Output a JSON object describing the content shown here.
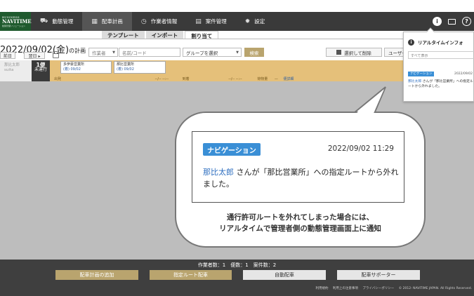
{
  "logo": {
    "line1": "BUSINESS",
    "line2": "NAVITIME",
    "line3": "動態管理ソリューション"
  },
  "nav": {
    "items": [
      {
        "label": "動態管理",
        "icon": "truck-icon"
      },
      {
        "label": "配車計画",
        "icon": "calendar-icon"
      },
      {
        "label": "作業者情報",
        "icon": "clock-icon"
      },
      {
        "label": "案件管理",
        "icon": "document-icon"
      },
      {
        "label": "設定",
        "icon": "gear-icon"
      }
    ],
    "active": "配車計画"
  },
  "subtabs": [
    "テンプレート",
    "インポート",
    "割り当て"
  ],
  "plan": {
    "date": "2022/09/02(金)",
    "suffix": "の計画",
    "prev_label": "前日",
    "next_label": "翌日 ▸"
  },
  "filters": {
    "worker_placeholder": "作業者",
    "name_placeholder": "名前/コード",
    "group_placeholder": "グループを選択",
    "search_label": "検索",
    "delete_label": "選択して削除",
    "user_label": "ユーザー"
  },
  "schedule": {
    "worker_name": "那比太郎",
    "worker_sub": "suita",
    "trip_label": "1便",
    "trip_status": "未運行",
    "stops": [
      {
        "name": "多伊豪営業所",
        "time": "(着) 09/02"
      },
      {
        "name": "那比営業所",
        "time": "(着) 09/02"
      }
    ],
    "timeline": [
      "出発",
      "--/-- --:--",
      "到着",
      "--/-- --:--",
      "荷物量",
      "—",
      "便詳細"
    ]
  },
  "notice": {
    "badge": "ナビゲーション",
    "timestamp": "2022/09/02 11:29",
    "user": "那比太郎",
    "message": " さんが「那比営業所」への指定ルートから外れました。"
  },
  "caption": {
    "line1": "通行許可ルートを外れてしまった場合には、",
    "line2": "リアルタイムで管理者側の動態管理画面上に通知"
  },
  "realtime_panel": {
    "title": "リアルタイムインフォ",
    "filter": "すべて表示",
    "badge": "ナビゲーション",
    "timestamp": "2022/09/02",
    "user": "那比太郎",
    "message": " さんが「那比営業所」への指定ルートから外れました。"
  },
  "footer": {
    "counts": "作業者数：1　便数：1　案件数：2",
    "buttons": [
      "配車計画の追加",
      "指定ルート配車",
      "自動配車",
      "配車サポーター"
    ],
    "links": [
      "利用規約",
      "利用上の注意事項",
      "プライバシーポリシー",
      "© 2012- NAVITIME JAPAN. All Rights Reserved."
    ]
  }
}
